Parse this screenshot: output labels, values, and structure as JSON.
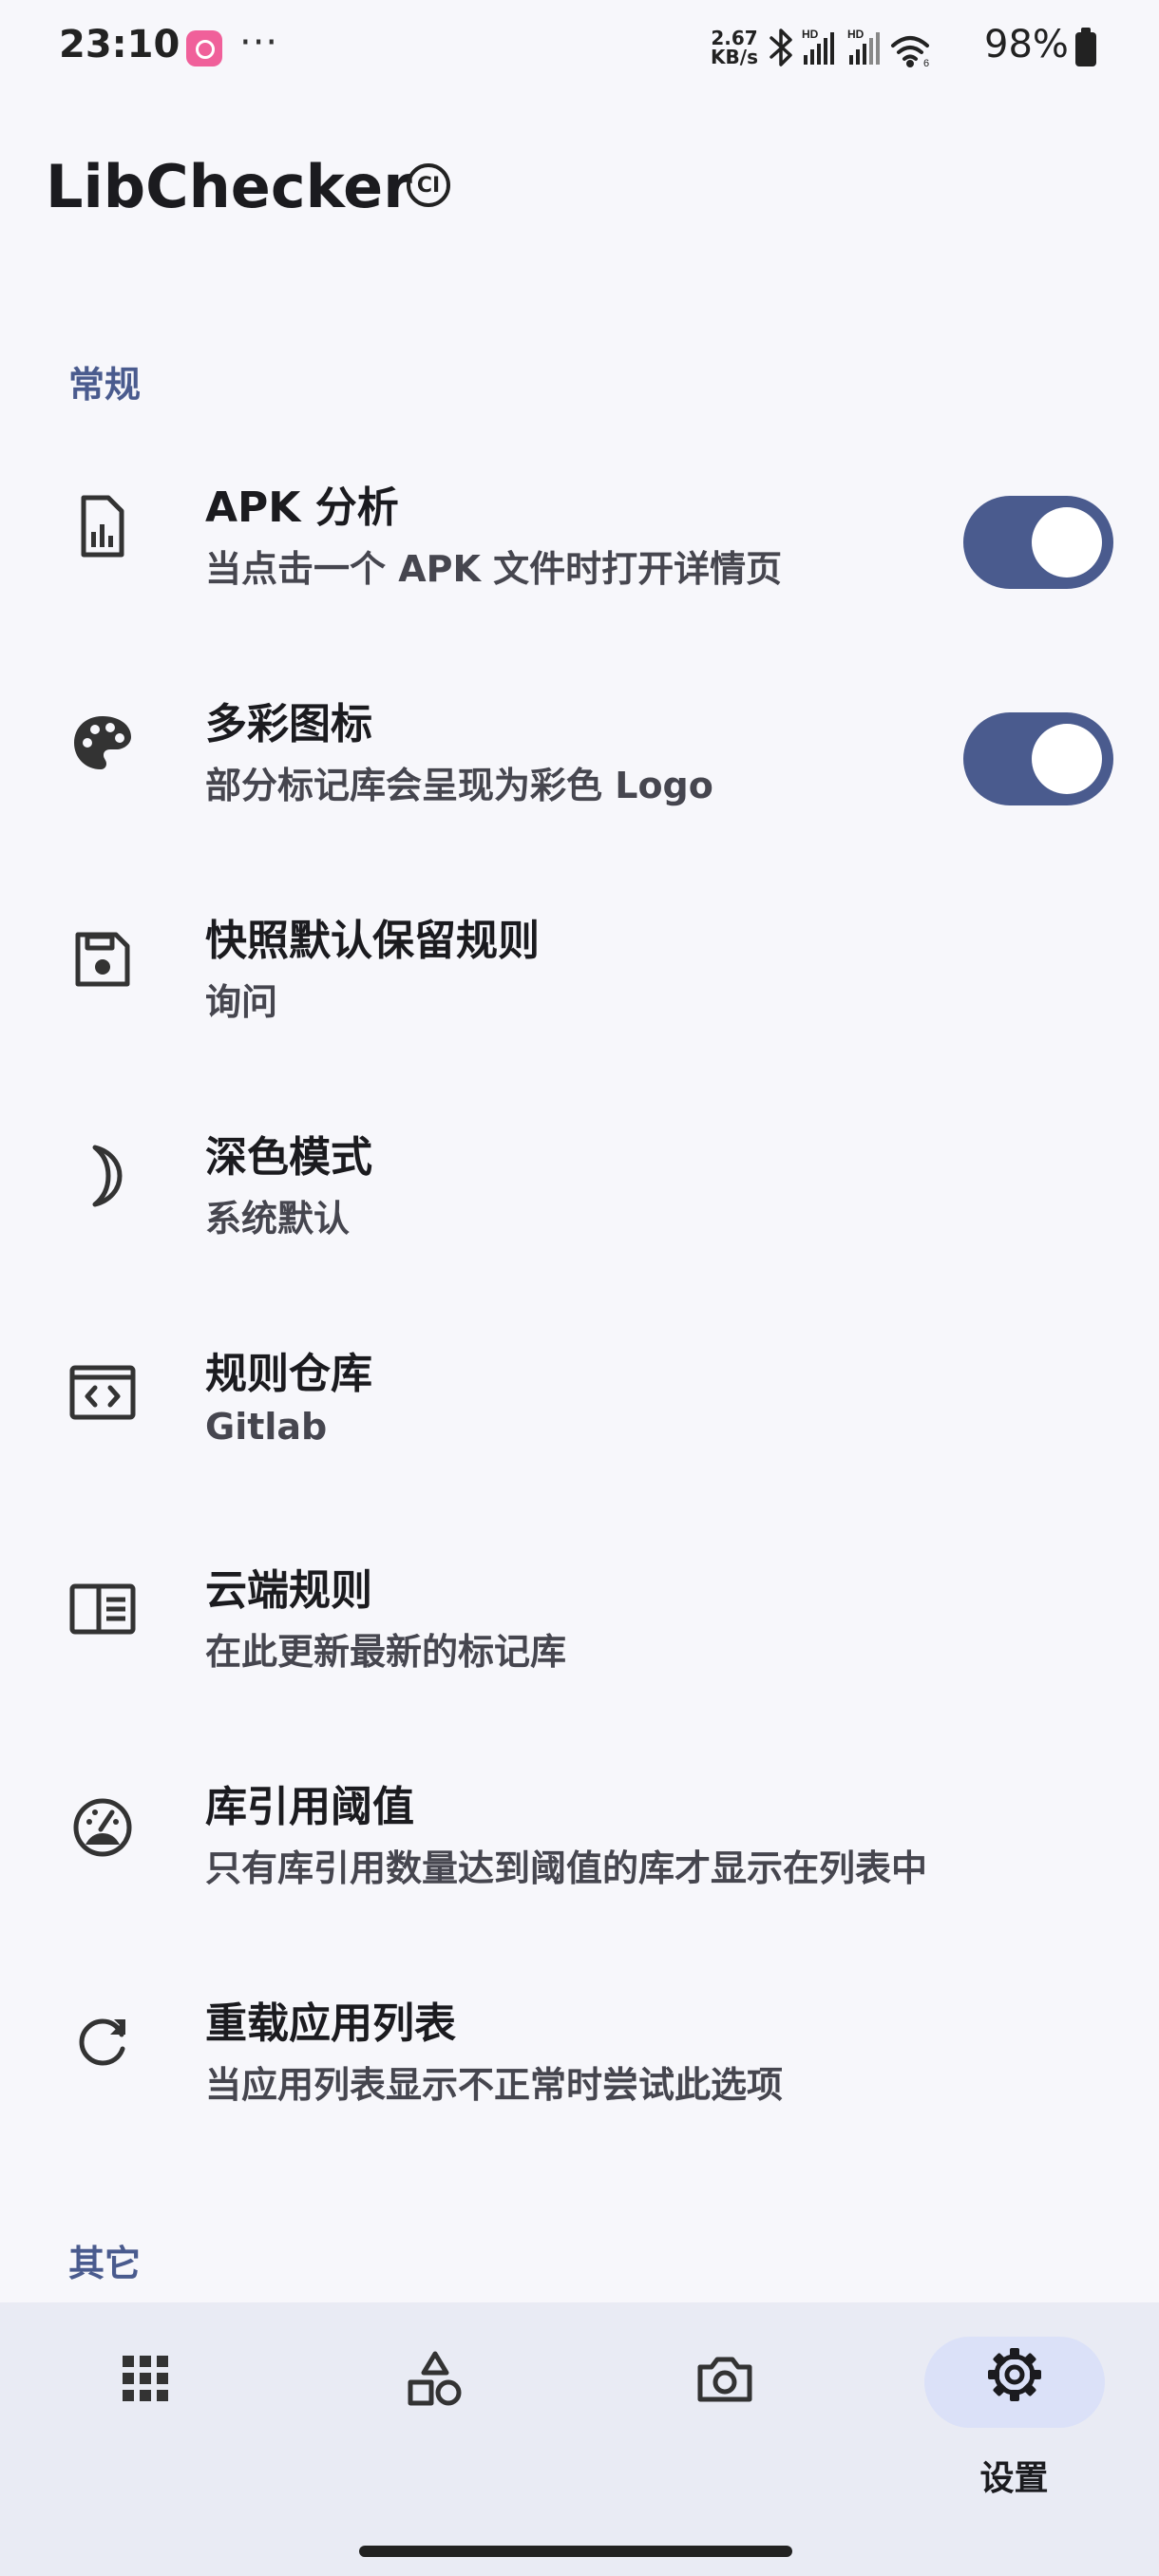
{
  "status_bar": {
    "time": "23:10",
    "dots": "···",
    "speed_value": "2.67",
    "speed_unit": "KB/s",
    "battery": "98%",
    "icons": [
      "bluetooth-icon",
      "signal-hd-icon",
      "signal-hd-icon",
      "wifi-icon",
      "battery-icon"
    ]
  },
  "header": {
    "title": "LibChecker",
    "badge": "CI"
  },
  "sections": {
    "general": "常规",
    "other": "其它"
  },
  "settings": [
    {
      "title": "APK 分析",
      "subtitle": "当点击一个 APK 文件时打开详情页",
      "icon": "apk-analysis-icon",
      "toggle": true
    },
    {
      "title": "多彩图标",
      "subtitle": "部分标记库会呈现为彩色 Logo",
      "icon": "palette-icon",
      "toggle": true
    },
    {
      "title": "快照默认保留规则",
      "subtitle": "询问",
      "icon": "save-icon"
    },
    {
      "title": "深色模式",
      "subtitle": "系统默认",
      "icon": "moon-icon"
    },
    {
      "title": "规则仓库",
      "subtitle": "Gitlab",
      "icon": "code-icon"
    },
    {
      "title": "云端规则",
      "subtitle": "在此更新最新的标记库",
      "icon": "cloud-rules-icon"
    },
    {
      "title": "库引用阈值",
      "subtitle": "只有库引用数量达到阈值的库才显示在列表中",
      "icon": "gauge-icon"
    },
    {
      "title": "重载应用列表",
      "subtitle": "当应用列表显示不正常时尝试此选项",
      "icon": "reload-icon"
    }
  ],
  "bottom_nav": {
    "items": [
      {
        "icon": "apps-grid-icon",
        "label": ""
      },
      {
        "icon": "shapes-icon",
        "label": ""
      },
      {
        "icon": "camera-icon",
        "label": ""
      },
      {
        "icon": "gear-icon",
        "label": "设置",
        "selected": true
      }
    ]
  },
  "colors": {
    "accent": "#4a5b8e",
    "background": "#f7f7fb",
    "nav_background": "#e9ebf4",
    "nav_selected_pill": "#dbe1f8"
  }
}
